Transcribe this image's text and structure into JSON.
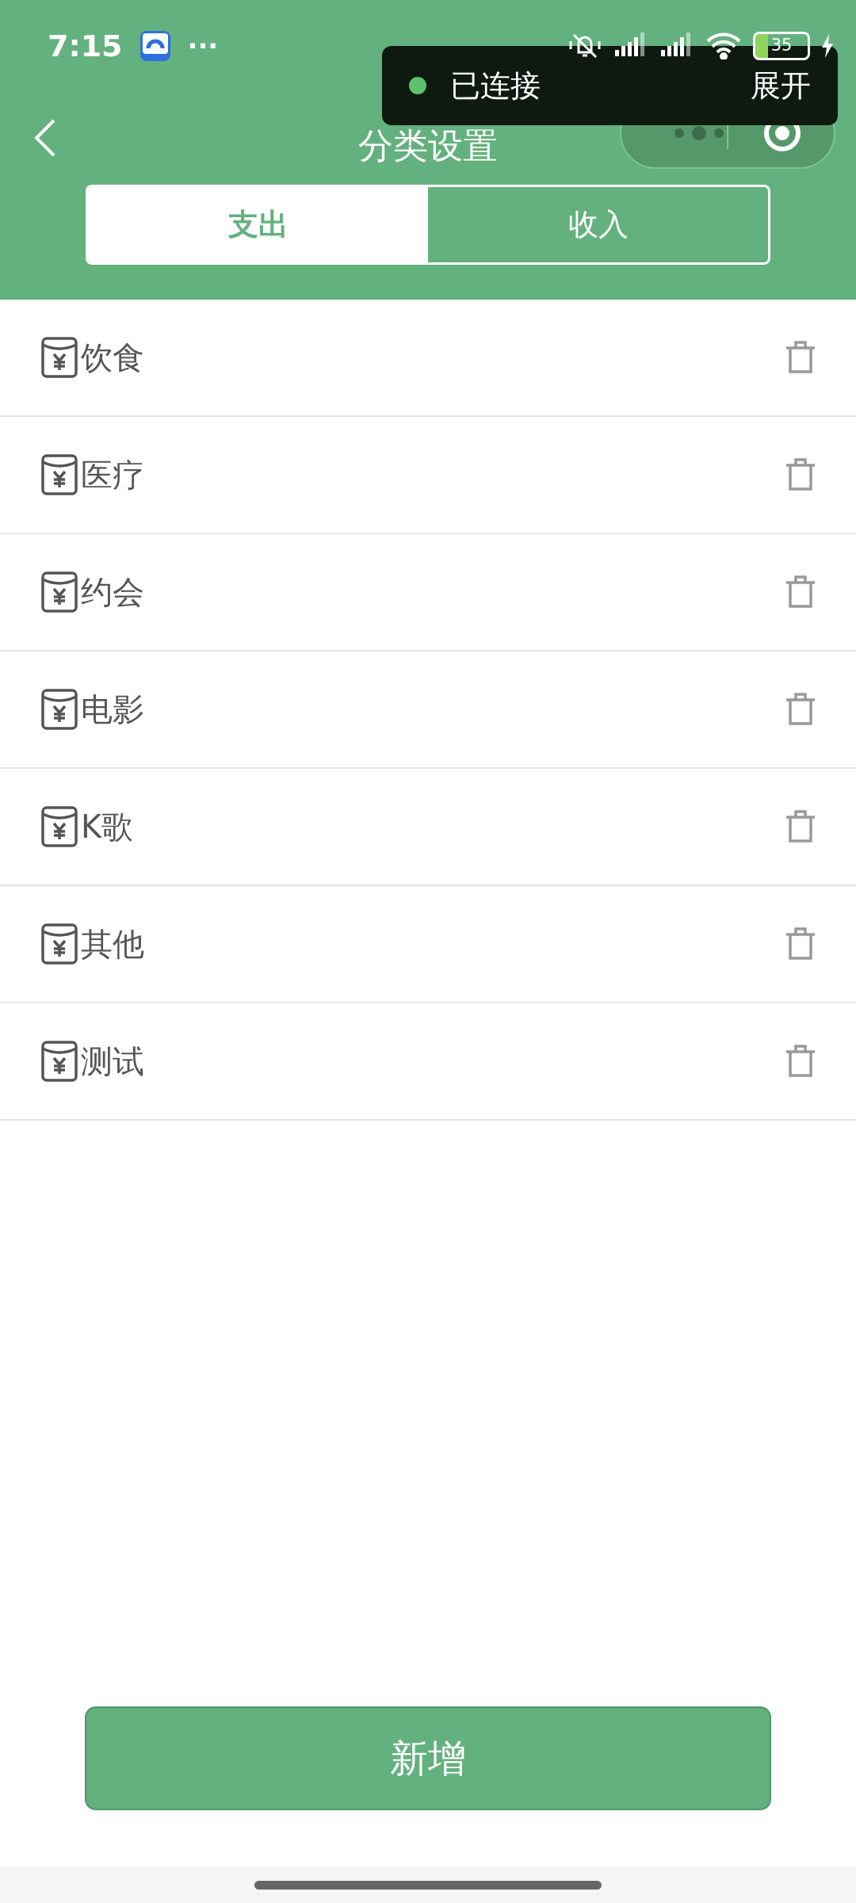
{
  "status_bar": {
    "time": "7:15",
    "more": "···",
    "battery": "35"
  },
  "toast": {
    "status": "已连接",
    "action": "展开",
    "connected": true
  },
  "nav": {
    "title": "分类设置"
  },
  "tabs": [
    {
      "label": "支出",
      "selected": true
    },
    {
      "label": "收入",
      "selected": false
    }
  ],
  "categories": [
    {
      "name": "饮食"
    },
    {
      "name": "医疗"
    },
    {
      "name": "约会"
    },
    {
      "name": "电影"
    },
    {
      "name": "K歌"
    },
    {
      "name": "其他"
    },
    {
      "name": "测试"
    }
  ],
  "add_button": "新增"
}
